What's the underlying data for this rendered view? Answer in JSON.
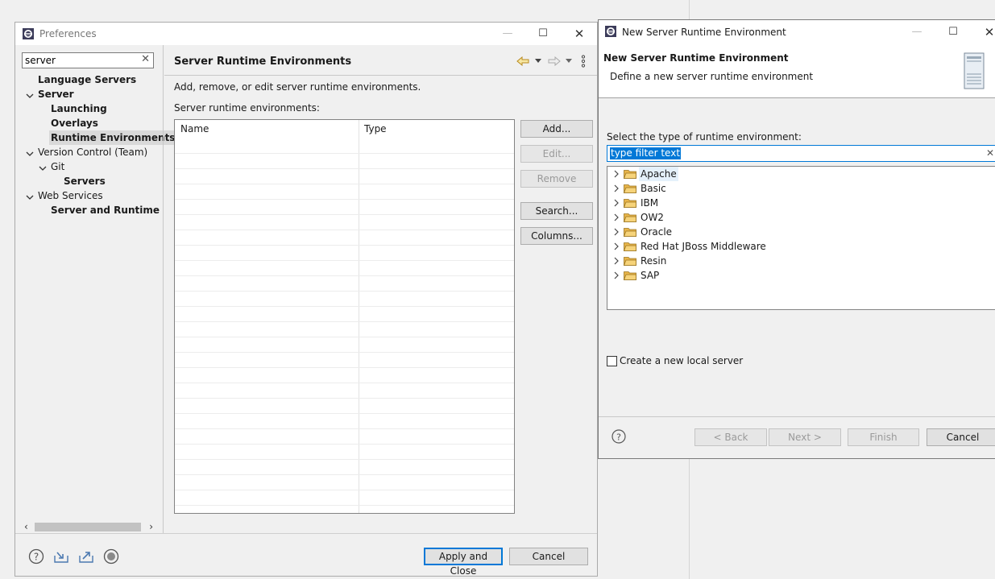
{
  "preferences": {
    "title": "Preferences",
    "filter_value": "server",
    "tree": [
      {
        "label": "Language Servers",
        "bold": true
      },
      {
        "label": "Server",
        "bold": true
      },
      {
        "label": "Launching",
        "bold": true
      },
      {
        "label": "Overlays",
        "bold": true
      },
      {
        "label": "Runtime Environments",
        "bold": true,
        "selected": true
      },
      {
        "label": "Version Control (Team)",
        "bold": false
      },
      {
        "label": "Git",
        "bold": false
      },
      {
        "label": "Servers",
        "bold": true
      },
      {
        "label": "Web Services",
        "bold": false
      },
      {
        "label": "Server and Runtime",
        "bold": true
      }
    ],
    "page": {
      "title": "Server Runtime Environments",
      "description": "Add, remove, or edit server runtime environments.",
      "list_label": "Server runtime environments:",
      "columns": [
        "Name",
        "Type"
      ]
    },
    "buttons": {
      "add": "Add...",
      "edit": "Edit...",
      "remove": "Remove",
      "search": "Search...",
      "columns": "Columns...",
      "apply_close": "Apply and Close",
      "cancel": "Cancel"
    }
  },
  "dialog": {
    "title": "New Server Runtime Environment",
    "header_title": "New Server Runtime Environment",
    "header_desc": "Define a new server runtime environment",
    "select_label": "Select the type of runtime environment:",
    "filter_text": "type filter text",
    "categories": [
      "Apache",
      "Basic",
      "IBM",
      "OW2",
      "Oracle",
      "Red Hat JBoss Middleware",
      "Resin",
      "SAP"
    ],
    "checkbox_label": "Create a new local server",
    "checkbox_checked": false,
    "buttons": {
      "back": "< Back",
      "next": "Next >",
      "finish": "Finish",
      "cancel": "Cancel"
    }
  },
  "colors": {
    "accent": "#0078d7",
    "folder": "#e8b54a"
  }
}
